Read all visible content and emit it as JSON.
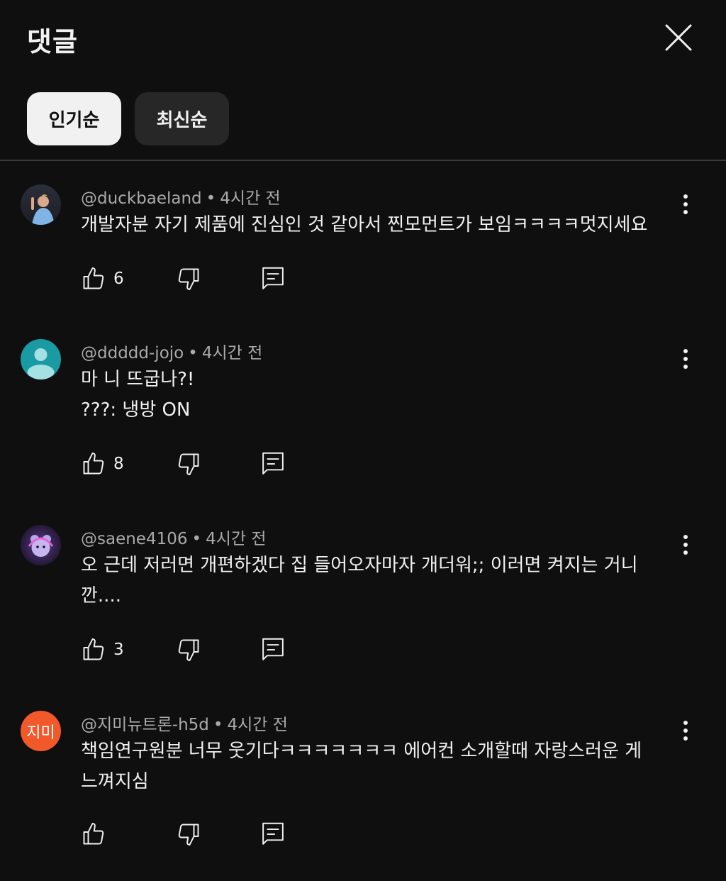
{
  "header": {
    "title": "댓글"
  },
  "sort_tabs": [
    {
      "label": "인기순",
      "active": true
    },
    {
      "label": "최신순",
      "active": false
    }
  ],
  "comments": [
    {
      "author": "@duckbaeland",
      "time": "4시간 전",
      "text": "개발자분 자기 제품에 진심인 것 같아서 찐모먼트가 보임ㅋㅋㅋㅋ멋지세요",
      "likes": "6",
      "avatar_text": ""
    },
    {
      "author": "@ddddd-jojo",
      "time": "4시간 전",
      "text": "마 니 뜨굽나?!\n???: 냉방 ON",
      "likes": "8",
      "avatar_text": ""
    },
    {
      "author": "@saene4106",
      "time": "4시간 전",
      "text": "오 근데 저러면 개편하겠다 집 들어오자마자 개더워;; 이러면 켜지는 거니\n깐....",
      "likes": "3",
      "avatar_text": ""
    },
    {
      "author": "@지미뉴트론-h5d",
      "time": "4시간 전",
      "text": "책임연구원분 너무 웃기다ㅋㅋㅋㅋㅋㅋㅋ 에어컨 소개할때 자랑스러운 게\n느껴지심",
      "likes": "",
      "avatar_text": "지미"
    }
  ],
  "colors": {
    "background": "#0f0f0f",
    "text": "#f1f1f1",
    "meta": "#aaaaaa",
    "chip_active": "#f1f1f1",
    "chip_idle": "#272727",
    "avatar_teal": "#1a9ba3",
    "avatar_orange": "#f1582a"
  },
  "icons": [
    "close-icon",
    "thumb-up-icon",
    "thumb-down-icon",
    "reply-icon",
    "more-vert-icon"
  ]
}
